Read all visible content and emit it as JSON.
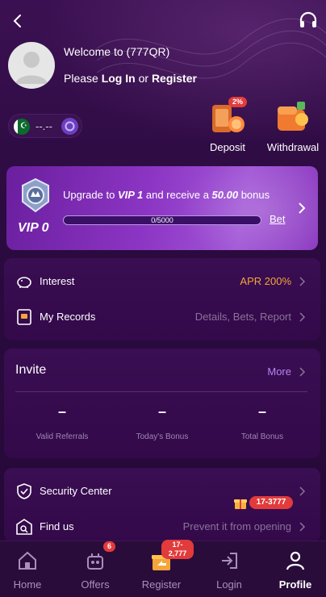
{
  "header": {
    "welcome": "Welcome to (777QR)",
    "please": "Please",
    "login": "Log In",
    "or": "or",
    "register": "Register"
  },
  "balance": {
    "value": "--.--"
  },
  "quick_actions": [
    {
      "label": "Deposit",
      "badge": "2%"
    },
    {
      "label": "Withdrawal"
    }
  ],
  "vip": {
    "level": "VIP 0",
    "upgrade_prefix": "Upgrade to ",
    "target": "VIP 1",
    "middle": " and receive a ",
    "amount": "50.00",
    "suffix": " bonus",
    "progress_text": "0/5000",
    "progress_fraction": 0.0,
    "bet": "Bet"
  },
  "records": [
    {
      "label": "Interest",
      "value": "APR 200%",
      "value_color": "#f3a53a"
    },
    {
      "label": "My Records",
      "value": "Details, Bets, Report",
      "value_color": "#8a7399"
    }
  ],
  "invite": {
    "title": "Invite",
    "more": "More",
    "stats": [
      {
        "value": "–",
        "label": "Valid Referrals"
      },
      {
        "value": "–",
        "label": "Today's Bonus"
      },
      {
        "value": "–",
        "label": "Total Bonus"
      }
    ]
  },
  "security": [
    {
      "label": "Security Center",
      "tag": "17-3777"
    },
    {
      "label": "Find us",
      "value": "Prevent it from opening"
    }
  ],
  "tabs": [
    {
      "label": "Home"
    },
    {
      "label": "Offers",
      "badge": "6"
    },
    {
      "label": "Register",
      "badge": "17-2,777"
    },
    {
      "label": "Login"
    },
    {
      "label": "Profile"
    }
  ],
  "colors": {
    "accent": "#8c35c4",
    "badge_red": "#e23b3b",
    "apr_orange": "#f3a53a",
    "more_purple": "#b685f0"
  }
}
